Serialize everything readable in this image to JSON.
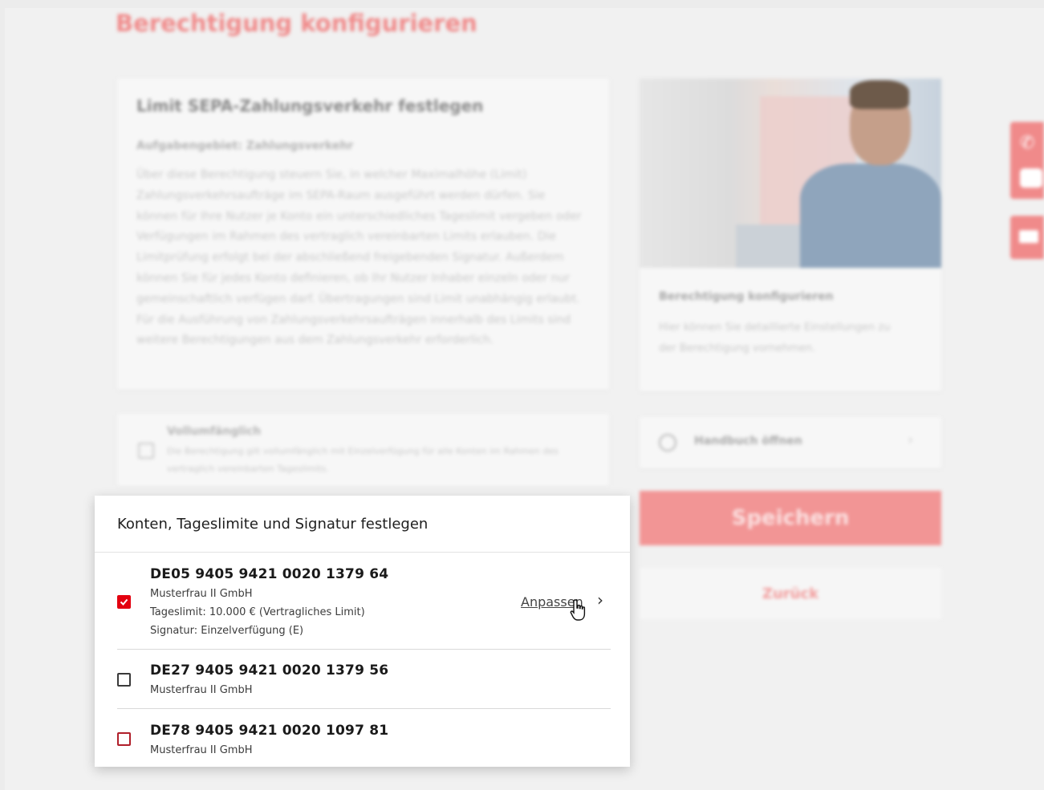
{
  "page": {
    "title": "Berechtigung konfigurieren",
    "colors": {
      "accent": "#e3000f",
      "accent_light": "#f29595"
    }
  },
  "info_card": {
    "heading": "Limit SEPA-Zahlungsverkehr festlegen",
    "subheading": "Aufgabengebiet: Zahlungsverkehr",
    "body": "Über diese Berechtigung steuern Sie, in welcher Maximalhöhe (Limit) Zahlungsverkehrsaufträge im SEPA-Raum ausgeführt werden dürfen. Sie können für Ihre Nutzer je Konto ein unterschiedliches Tageslimit vergeben oder Verfügungen im Rahmen des vertraglich vereinbarten Limits erlauben. Die Limitprüfung erfolgt bei der abschließend freigebenden Signatur. Außerdem können Sie für jedes Konto definieren, ob Ihr Nutzer Inhaber einzeln oder nur gemeinschaftlich verfügen darf. Übertragungen sind Limit unabhängig erlaubt. Für die Ausführung von Zahlungsverkehrsaufträgen innerhalb des Limits sind weitere Berechtigungen aus dem Zahlungsverkehr erforderlich."
  },
  "full_scope": {
    "label": "Vollumfänglich",
    "description": "Die Berechtigung gilt vollumfänglich mit Einzelverfügung für alle Konten im Rahmen des vertraglich vereinbarten Tageslimits."
  },
  "side_card": {
    "title": "Berechtigung konfigurieren",
    "body": "Hier können Sie detaillierte Einstellungen zu der Berechtigung vornehmen."
  },
  "manual": {
    "label": "Handbuch öffnen",
    "icon": "question-circle-icon"
  },
  "buttons": {
    "save": "Speichern",
    "back": "Zurück"
  },
  "floating": {
    "phone_icon": "phone-icon",
    "chat_icon": "chat-icon",
    "mail_icon": "mail-icon"
  },
  "panel": {
    "title": "Konten, Tageslimite und Signatur festlegen",
    "accounts": [
      {
        "iban": "DE05 9405 9421 0020 1379 64",
        "holder": "Musterfrau II GmbH",
        "limit": "Tageslimit: 10.000 € (Vertragliches Limit)",
        "signature": "Signatur: Einzelverfügung (E)",
        "checked": true,
        "action": "Anpassen"
      },
      {
        "iban": "DE27 9405 9421 0020 1379 56",
        "holder": "Musterfrau II GmbH",
        "checked": false
      },
      {
        "iban": "DE78 9405 9421 0020 1097 81",
        "holder": "Musterfrau II GmbH",
        "checked": false
      }
    ]
  }
}
